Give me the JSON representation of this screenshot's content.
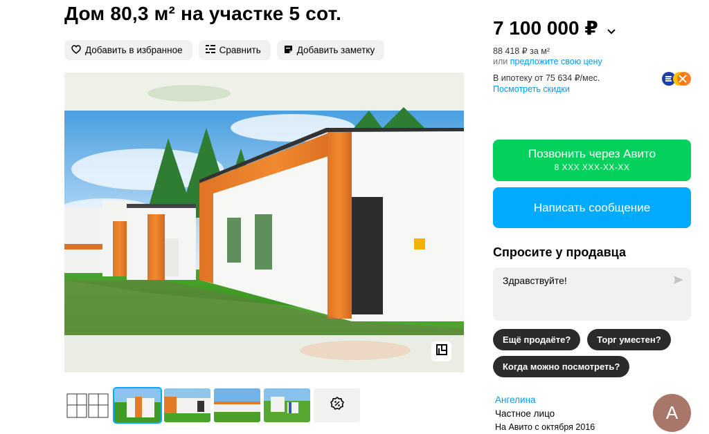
{
  "listing": {
    "title": "Дом 80,3 м² на участке 5 сот."
  },
  "actions": {
    "favorite_label": "Добавить в избранное",
    "compare_label": "Сравнить",
    "note_label": "Добавить заметку"
  },
  "price": {
    "value": "7 100 000 ₽",
    "per_meter": "88 418 ₽ за м²",
    "offer_prefix": "или ",
    "offer_link": "предложите свою цену",
    "mortgage": "В ипотеку от 75 634 ₽/мес.",
    "discounts_link": "Посмотреть скидки"
  },
  "contact": {
    "call_label": "Позвонить через Авито",
    "call_phone": "8 XXX XXX-XX-XX",
    "message_label": "Написать сообщение"
  },
  "ask": {
    "title": "Спросите у продавца",
    "input_value": "Здравствуйте!",
    "chips": [
      "Ещё продаёте?",
      "Торг уместен?",
      "Когда можно посмотреть?"
    ]
  },
  "seller": {
    "name": "Ангелина",
    "type": "Частное лицо",
    "since": "На Авито с октября 2016",
    "avatar_letter": "А"
  },
  "icons": {
    "favorite": "heart-icon",
    "compare": "compare-icon",
    "note": "note-icon",
    "price_menu": "chevron-down-icon",
    "send": "send-icon",
    "floor_plan": "floor-plan-icon",
    "more_photos": "percent-badge-icon"
  },
  "colors": {
    "call_button": "#02d15c",
    "message_button": "#00aaff",
    "link": "#0099f7",
    "chip": "#2b2b2b",
    "avatar": "#a8776a"
  }
}
